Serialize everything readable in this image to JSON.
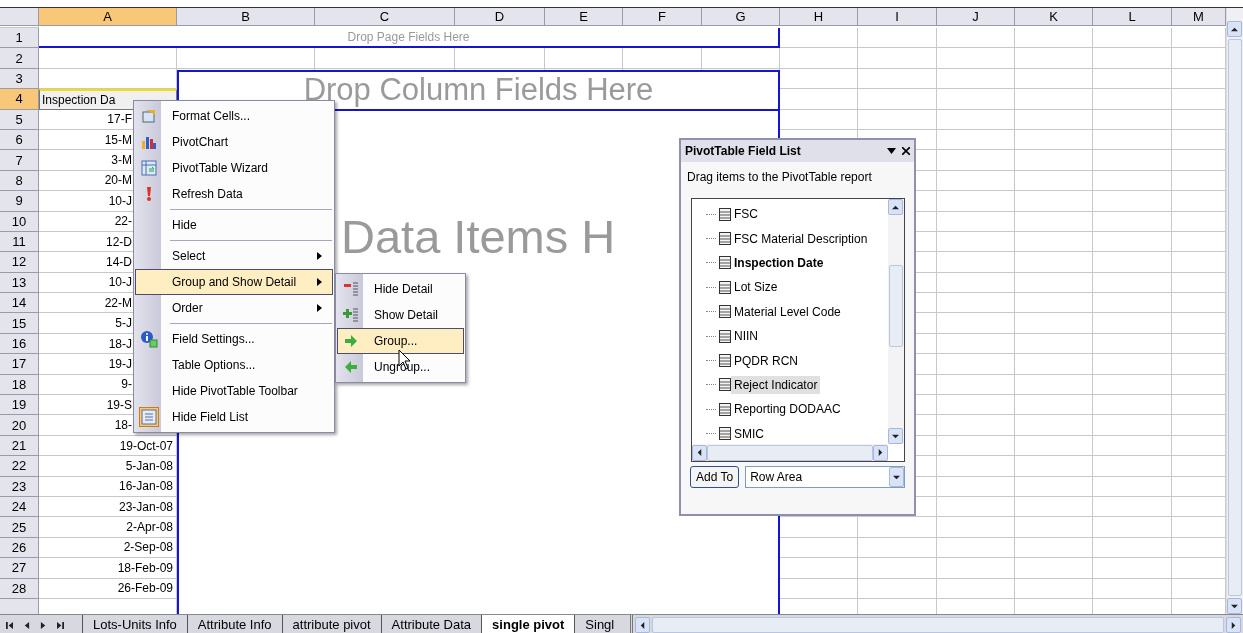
{
  "columns": [
    {
      "label": "A",
      "selected": true
    },
    {
      "label": "B",
      "selected": false
    },
    {
      "label": "C",
      "selected": false
    },
    {
      "label": "D",
      "selected": false
    },
    {
      "label": "E",
      "selected": false
    },
    {
      "label": "F",
      "selected": false
    },
    {
      "label": "G",
      "selected": false
    },
    {
      "label": "H",
      "selected": false
    },
    {
      "label": "I",
      "selected": false
    },
    {
      "label": "J",
      "selected": false
    },
    {
      "label": "K",
      "selected": false
    },
    {
      "label": "L",
      "selected": false
    },
    {
      "label": "M",
      "selected": false
    }
  ],
  "rows": [
    {
      "number": "1",
      "selected": false
    },
    {
      "number": "2",
      "selected": false
    },
    {
      "number": "3",
      "selected": false
    },
    {
      "number": "4",
      "selected": true,
      "field": "Inspection Da"
    },
    {
      "number": "5",
      "selected": false,
      "value": "17-F",
      "covered": true
    },
    {
      "number": "6",
      "selected": false,
      "value": "15-M",
      "covered": true
    },
    {
      "number": "7",
      "selected": false,
      "value": "3-M",
      "covered": true
    },
    {
      "number": "8",
      "selected": false,
      "value": "20-M",
      "covered": true
    },
    {
      "number": "9",
      "selected": false,
      "value": "10-J",
      "covered": true
    },
    {
      "number": "10",
      "selected": false,
      "value": "22-",
      "covered": true
    },
    {
      "number": "11",
      "selected": false,
      "value": "12-D",
      "covered": true
    },
    {
      "number": "12",
      "selected": false,
      "value": "14-D",
      "covered": true
    },
    {
      "number": "13",
      "selected": false,
      "value": "10-J",
      "covered": true
    },
    {
      "number": "14",
      "selected": false,
      "value": "22-M",
      "covered": true
    },
    {
      "number": "15",
      "selected": false,
      "value": "5-J",
      "covered": true
    },
    {
      "number": "16",
      "selected": false,
      "value": "18-J",
      "covered": true
    },
    {
      "number": "17",
      "selected": false,
      "value": "19-J",
      "covered": true
    },
    {
      "number": "18",
      "selected": false,
      "value": "9-",
      "covered": true
    },
    {
      "number": "19",
      "selected": false,
      "value": "19-S",
      "covered": true
    },
    {
      "number": "20",
      "selected": false,
      "value": "18-",
      "covered": true
    },
    {
      "number": "21",
      "selected": false,
      "value": "19-Oct-07",
      "covered": false
    },
    {
      "number": "22",
      "selected": false,
      "value": "5-Jan-08",
      "covered": false
    },
    {
      "number": "23",
      "selected": false,
      "value": "16-Jan-08",
      "covered": false
    },
    {
      "number": "24",
      "selected": false,
      "value": "23-Jan-08",
      "covered": false
    },
    {
      "number": "25",
      "selected": false,
      "value": "2-Apr-08",
      "covered": false
    },
    {
      "number": "26",
      "selected": false,
      "value": "2-Sep-08",
      "covered": false
    },
    {
      "number": "27",
      "selected": false,
      "value": "18-Feb-09",
      "covered": false
    },
    {
      "number": "28",
      "selected": false,
      "value": "26-Feb-09",
      "covered": false
    }
  ],
  "pivot": {
    "page_area": "Drop Page Fields Here",
    "column_area": "Drop Column Fields Here",
    "data_area": "Data Items H"
  },
  "context_menu": [
    [
      {
        "label": "Format Cells...",
        "selected": false,
        "checked": false,
        "submenu": false
      },
      {
        "label": "PivotChart",
        "selected": false,
        "checked": false,
        "submenu": false
      },
      {
        "label": "PivotTable Wizard",
        "selected": false,
        "checked": false,
        "submenu": false
      },
      {
        "label": "Refresh Data",
        "selected": false,
        "checked": false,
        "submenu": false
      }
    ],
    [
      {
        "label": "Hide",
        "selected": false,
        "checked": false,
        "submenu": false
      }
    ],
    [
      {
        "label": "Select",
        "selected": false,
        "checked": false,
        "submenu": true
      },
      {
        "label": "Group and Show Detail",
        "selected": true,
        "checked": false,
        "submenu": true
      },
      {
        "label": "Order",
        "selected": false,
        "checked": false,
        "submenu": true
      }
    ],
    [
      {
        "label": "Field Settings...",
        "selected": false,
        "checked": false,
        "submenu": false
      },
      {
        "label": "Table Options...",
        "selected": false,
        "checked": false,
        "submenu": false
      },
      {
        "label": "Hide PivotTable Toolbar",
        "selected": false,
        "checked": false,
        "submenu": false
      },
      {
        "label": "Hide Field List",
        "selected": false,
        "checked": true,
        "submenu": false
      }
    ]
  ],
  "submenu": [
    {
      "label": "Hide Detail",
      "selected": false
    },
    {
      "label": "Show Detail",
      "selected": false
    },
    {
      "label": "Group...",
      "selected": true
    },
    {
      "label": "Ungroup...",
      "selected": false
    }
  ],
  "field_list": {
    "title": "PivotTable Field List",
    "hint": "Drag items to the PivotTable report",
    "fields": [
      {
        "label": "FSC",
        "in_report": false,
        "selected": false
      },
      {
        "label": "FSC Material Description",
        "in_report": false,
        "selected": false
      },
      {
        "label": "Inspection Date",
        "in_report": true,
        "selected": false
      },
      {
        "label": "Lot Size",
        "in_report": false,
        "selected": false
      },
      {
        "label": "Material Level Code",
        "in_report": false,
        "selected": false
      },
      {
        "label": "NIIN",
        "in_report": false,
        "selected": false
      },
      {
        "label": "PQDR RCN",
        "in_report": false,
        "selected": false
      },
      {
        "label": "Reject Indicator",
        "in_report": false,
        "selected": true
      },
      {
        "label": "Reporting DODAAC",
        "in_report": false,
        "selected": false
      },
      {
        "label": "SMIC",
        "in_report": false,
        "selected": false
      }
    ],
    "add_button": "Add To",
    "area": "Row Area"
  },
  "sheet_tabs": [
    {
      "label": "Lots-Units Info",
      "selected": false
    },
    {
      "label": "Attribute Info",
      "selected": false
    },
    {
      "label": "attribute pivot",
      "selected": false
    },
    {
      "label": "Attribute Data",
      "selected": false
    },
    {
      "label": "single pivot",
      "selected": true
    },
    {
      "label": "Singl",
      "selected": false
    }
  ]
}
